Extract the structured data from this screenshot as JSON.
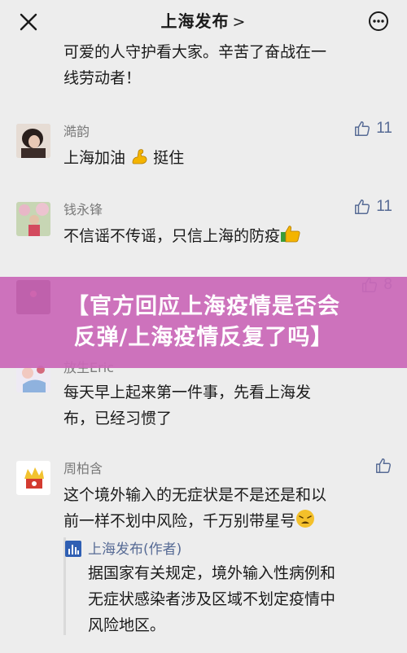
{
  "header": {
    "title": "上海发布",
    "title_chevron": ">",
    "close_icon": "close-icon",
    "more_icon": "more-icon"
  },
  "top_fragment": {
    "line1": "可爱的人守护看大家。辛苦了奋战在一",
    "line2": "线劳动者！"
  },
  "comments": [
    {
      "name": "澔韵",
      "likes": "11",
      "text_before": "上海加油",
      "text_after": "挺住",
      "emoji": "flexed-biceps"
    },
    {
      "name": "钱永锋",
      "likes": "11",
      "text_before": "不信谣不传谣，只信上海的防疫",
      "emoji": "thumbs-up"
    },
    {
      "name": "",
      "likes": "8"
    },
    {
      "name": "放生Eric",
      "likes": "",
      "line1": "每天早上起来第一件事，先看上海发",
      "line2": "布，已经习惯了"
    },
    {
      "name": "周柏含",
      "likes": "",
      "line1": "这个境外输入的无症状是不是还是和以",
      "line2": "前一样不划中风险，千万别带星号",
      "emoji": "weary-face"
    }
  ],
  "reply": {
    "name": "上海发布(作者)",
    "line1": "据国家有关规定，境外输入性病例和",
    "line2": "无症状感染者涉及区域不划定疫情中",
    "line3": "风险地区。"
  },
  "banner": {
    "line1": "【官方回应上海疫情是否会",
    "line2": "反弹/上海疫情反复了吗】"
  },
  "colors": {
    "background": "#ededed",
    "link_blue": "#576b95",
    "banner_pink": "#ca68b8",
    "name_gray": "#7a7a7a"
  }
}
